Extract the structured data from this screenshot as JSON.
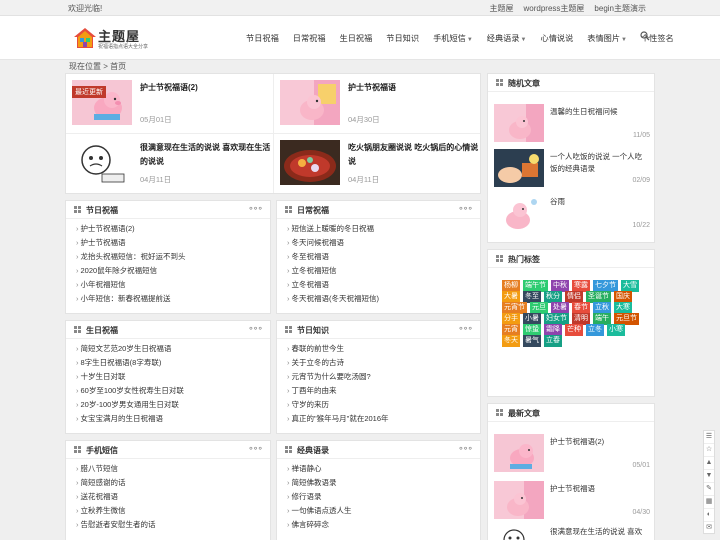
{
  "topbar": {
    "welcome": "欢迎光临!",
    "links": [
      "主题屋",
      "wordpress主题屋",
      "begin主题演示"
    ]
  },
  "logo": {
    "title": "主题屋",
    "slogan": "祝福语指点语大全分享"
  },
  "nav": {
    "items": [
      {
        "label": "节日祝福",
        "has_sub": false
      },
      {
        "label": "日常祝福",
        "has_sub": false
      },
      {
        "label": "生日祝福",
        "has_sub": false
      },
      {
        "label": "节日知识",
        "has_sub": false
      },
      {
        "label": "手机短信",
        "has_sub": true
      },
      {
        "label": "经典语录",
        "has_sub": true
      },
      {
        "label": "心情说说",
        "has_sub": false
      },
      {
        "label": "表情图片",
        "has_sub": true
      },
      {
        "label": "个性签名",
        "has_sub": false
      }
    ]
  },
  "breadcrumb": {
    "label": "现在位置",
    "sep": ">",
    "home": "首页"
  },
  "featured": [
    {
      "title": "护士节祝福语(2)",
      "date": "05月01日",
      "badge": "最近更新"
    },
    {
      "title": "护士节祝福语",
      "date": "04月30日"
    },
    {
      "title": "很满意现在生活的说说 喜欢现在生活的说说",
      "date": "04月11日"
    },
    {
      "title": "吃火锅朋友圈说说 吃火锅后的心情说说",
      "date": "04月11日"
    }
  ],
  "sections": [
    {
      "title": "节日祝福",
      "items": [
        "护士节祝福语(2)",
        "护士节祝福语",
        "龙抬头祝福短信：祝好运不到头",
        "2020鼠年除夕祝福短信",
        "小年祝福短信",
        "小年短信：新春祝福提前送"
      ]
    },
    {
      "title": "日常祝福",
      "items": [
        "短信送上暖暖的冬日祝福",
        "冬天问候祝福语",
        "冬至祝福语",
        "立冬祝福短信",
        "立冬祝福语",
        "冬天祝福语(冬天祝福短信)"
      ]
    },
    {
      "title": "生日祝福",
      "items": [
        "简短文艺范20岁生日祝福语",
        "8字生日祝福语(8字寿联)",
        "十岁生日对联",
        "60岁至100岁女性祝寿生日对联",
        "20岁-100岁男女通用生日对联",
        "女宝宝满月的生日祝福语"
      ]
    },
    {
      "title": "节日知识",
      "items": [
        "春联的前世今生",
        "关于立冬的古诗",
        "元宵节为什么要吃汤圆?",
        "丁酉年的由来",
        "守岁的来历",
        "真正的\"猴年马月\"就在2016年"
      ]
    },
    {
      "title": "手机短信",
      "items": [
        "腊八节短信",
        "简短感谢的话",
        "送花祝福语",
        "立秋养生微信",
        "告慰逝者安慰生者的话"
      ]
    },
    {
      "title": "经典语录",
      "items": [
        "禅语静心",
        "简短佛教语录",
        "修行语录",
        "一句佛语点透人生",
        "佛言碎碎念"
      ]
    }
  ],
  "sidebar": {
    "random": {
      "title": "随机文章",
      "items": [
        {
          "title": "温馨的生日祝福问候",
          "date": "11/05"
        },
        {
          "title": "一个人吃饭的说说 一个人吃饭的经典语录",
          "date": "02/09"
        },
        {
          "title": "谷雨",
          "date": "10/22"
        }
      ]
    },
    "tags": {
      "title": "热门标签",
      "list": [
        "杨柳",
        "端午节",
        "中秋",
        "寒露",
        "七夕节",
        "大雪",
        "大暑",
        "冬至",
        "秋分",
        "情侣",
        "圣诞节",
        "国庆",
        "元宵节",
        "元旦",
        "处暑",
        "春节",
        "立秋",
        "大寒",
        "分手",
        "小暑",
        "妇女节",
        "清明",
        "端午",
        "元旦节",
        "元宵",
        "惊蛰",
        "霜降",
        "芒种",
        "立冬",
        "小寒",
        "冬天",
        "暑气",
        "立春"
      ],
      "colors": [
        "#e67e22",
        "#2ecc71",
        "#8e44ad",
        "#e74c3c",
        "#3498db",
        "#1abc9c",
        "#f39c12",
        "#34495e",
        "#16a085",
        "#c0392b",
        "#27ae60",
        "#d35400"
      ]
    },
    "latest": {
      "title": "最新文章",
      "items": [
        {
          "title": "护士节祝福语(2)",
          "date": "05/01"
        },
        {
          "title": "护士节祝福语",
          "date": "04/30"
        },
        {
          "title": "很满意现在生活的说说 喜欢现",
          "date": ""
        }
      ]
    }
  },
  "float_tools": [
    "分享",
    "收藏",
    "顶部",
    "底部",
    "评论",
    "二维码",
    "主题",
    "联系"
  ],
  "colors": {
    "accent": "#c0392b",
    "bg": "#efefef"
  }
}
